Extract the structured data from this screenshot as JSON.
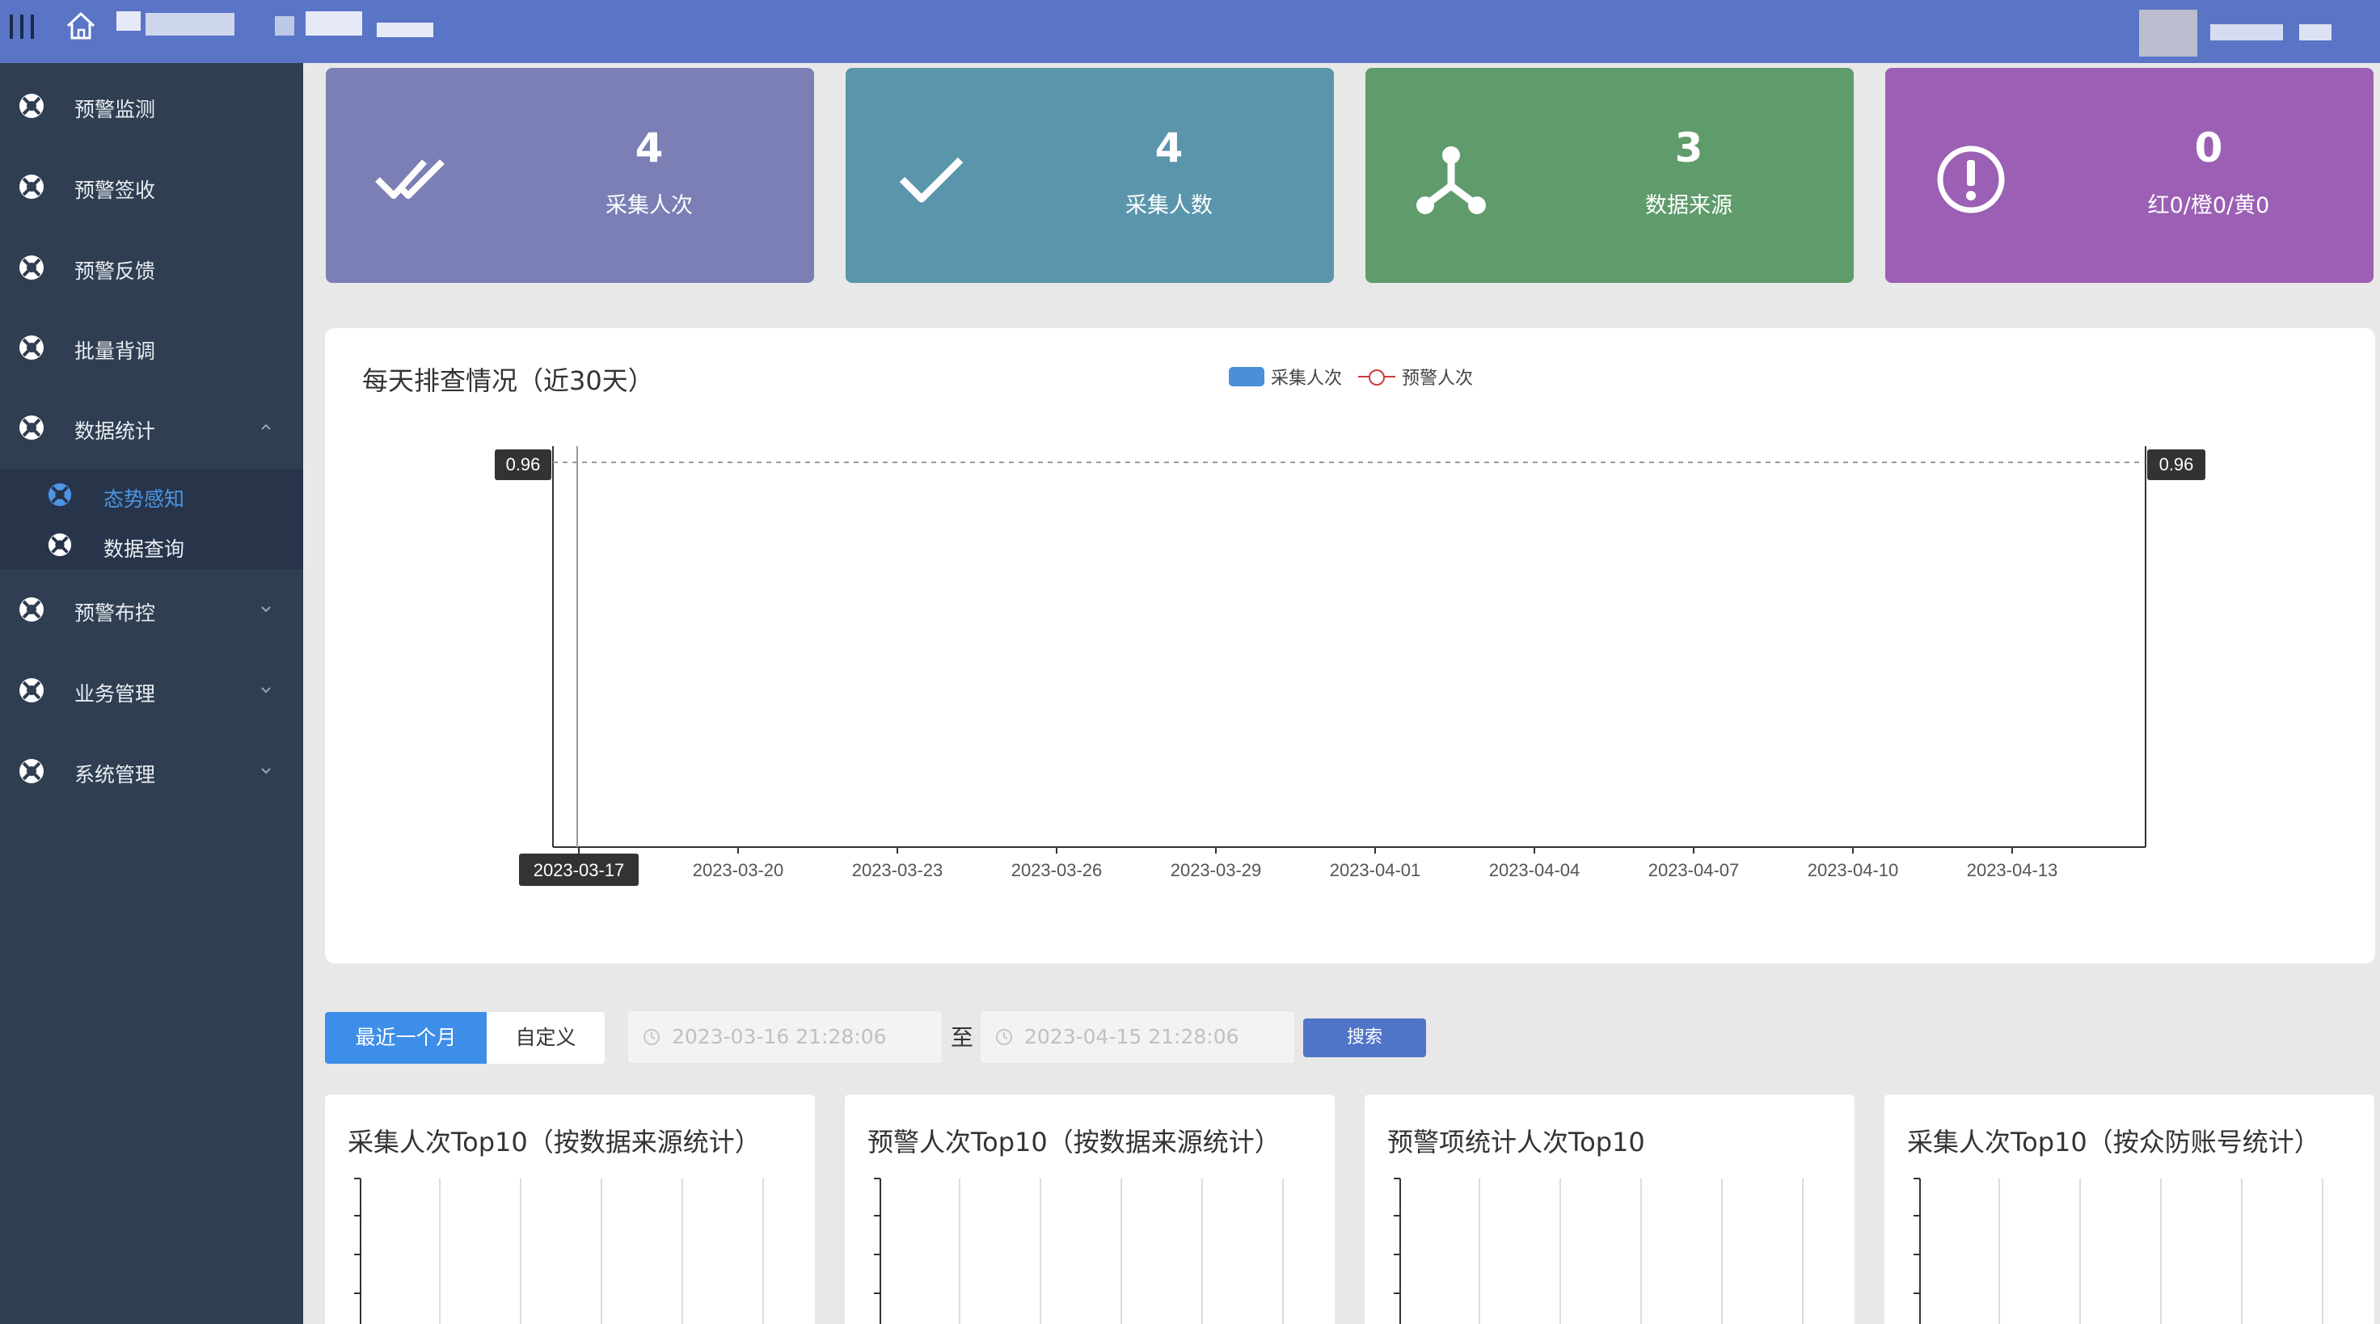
{
  "sidebar": {
    "items": [
      {
        "label": "预警监测"
      },
      {
        "label": "预警签收"
      },
      {
        "label": "预警反馈"
      },
      {
        "label": "批量背调"
      },
      {
        "label": "数据统计"
      },
      {
        "label": "预警布控"
      },
      {
        "label": "业务管理"
      },
      {
        "label": "系统管理"
      }
    ],
    "subitems": [
      {
        "label": "态势感知",
        "active": true
      },
      {
        "label": "数据查询",
        "active": false
      }
    ]
  },
  "cards": [
    {
      "value": "4",
      "label": "采集人次",
      "color": "#7b7fb5",
      "icon": "double-check-icon"
    },
    {
      "value": "4",
      "label": "采集人数",
      "color": "#5a95ab",
      "icon": "check-icon"
    },
    {
      "value": "3",
      "label": "数据来源",
      "color": "#5f9b6b",
      "icon": "network-icon"
    },
    {
      "value": "0",
      "label": "红0/橙0/黄0",
      "color": "#9b5fb4",
      "icon": "alert-circle-icon"
    }
  ],
  "chart_panel": {
    "title": "每天排查情况（近30天）",
    "legend": [
      "采集人次",
      "预警人次"
    ]
  },
  "chart_data": {
    "type": "bar",
    "title": "每天排查情况（近30天）",
    "x_tick_labels": [
      "2023-03-17",
      "2023-03-20",
      "2023-03-23",
      "2023-03-26",
      "2023-03-29",
      "2023-04-01",
      "2023-04-04",
      "2023-04-07",
      "2023-04-10",
      "2023-04-13"
    ],
    "series": [
      {
        "name": "采集人次",
        "type": "bar",
        "color": "#4b8fd6"
      },
      {
        "name": "预警人次",
        "type": "line",
        "color": "#d03a3a"
      }
    ],
    "axis_pointer_value": "0.96",
    "highlighted_x": "2023-03-17",
    "grid": false,
    "legend_position": "top-center"
  },
  "filters": {
    "range_active": "最近一个月",
    "range_custom": "自定义",
    "start_placeholder": "2023-03-16 21:28:06",
    "end_placeholder": "2023-04-15 21:28:06",
    "to_label": "至",
    "search_label": "搜索"
  },
  "bottom_cards": [
    {
      "title": "采集人次Top10（按数据来源统计）"
    },
    {
      "title": "预警人次Top10（按数据来源统计）"
    },
    {
      "title": "预警项统计人次Top10"
    },
    {
      "title": "采集人次Top10（按众防账号统计）"
    }
  ]
}
